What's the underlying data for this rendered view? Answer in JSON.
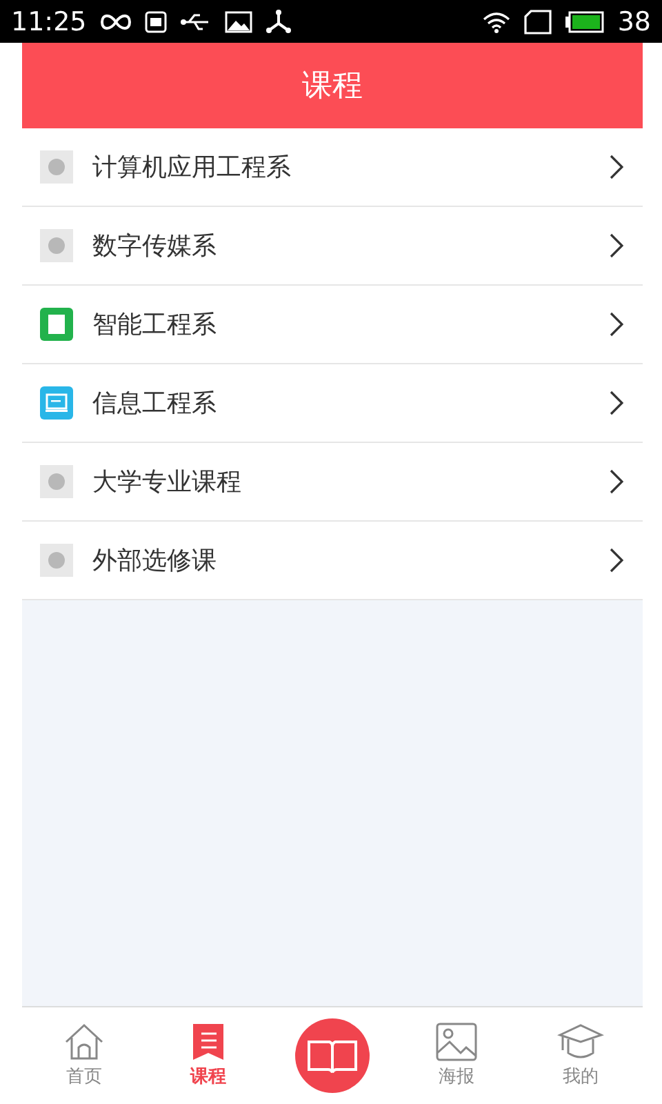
{
  "status_bar": {
    "time": "11:25",
    "battery": "38"
  },
  "header": {
    "title": "课程"
  },
  "list": [
    {
      "label": "计算机应用工程系",
      "kind": "placeholder"
    },
    {
      "label": "数字传媒系",
      "kind": "placeholder"
    },
    {
      "label": "智能工程系",
      "kind": "book"
    },
    {
      "label": "信息工程系",
      "kind": "laptop"
    },
    {
      "label": "大学专业课程",
      "kind": "placeholder"
    },
    {
      "label": "外部选修课",
      "kind": "placeholder"
    }
  ],
  "tab_bar": [
    {
      "kind": "home",
      "label": "首页",
      "selected": false
    },
    {
      "kind": "list",
      "label": "课程",
      "selected": true
    },
    {
      "kind": "center"
    },
    {
      "kind": "picture",
      "label": "海报",
      "selected": false
    },
    {
      "kind": "cap",
      "label": "我的",
      "selected": false
    }
  ]
}
